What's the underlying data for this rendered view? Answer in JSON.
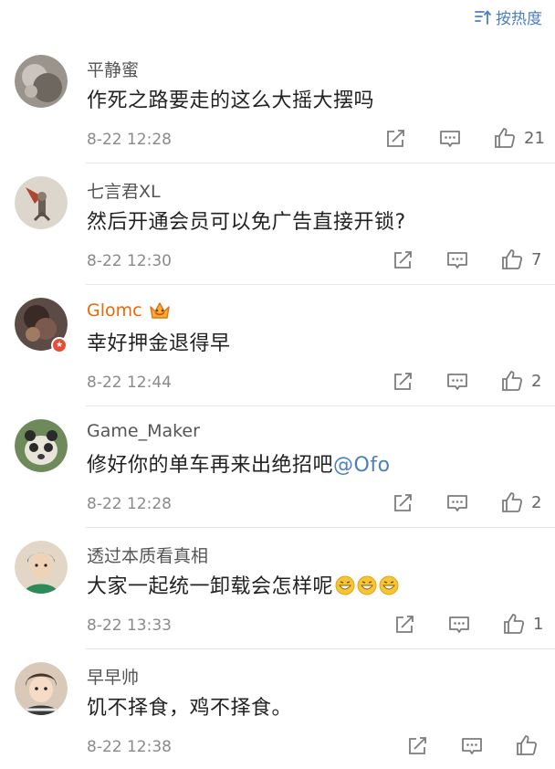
{
  "sort": {
    "label": "按热度",
    "icon": "sort-icon"
  },
  "comments": [
    {
      "user": "平静蜜",
      "text": "作死之路要走的这么大摇大摆吗",
      "time": "8-22 12:28",
      "likes": "21",
      "avatar_color": "#8a8580"
    },
    {
      "user": "七言君XL",
      "text": "然后开通会员可以免广告直接开锁?",
      "time": "8-22 12:30",
      "likes": "7",
      "avatar_color": "#c9c2b6"
    },
    {
      "user": "Glomc",
      "text": "幸好押金退得早",
      "time": "8-22 12:44",
      "likes": "2",
      "vip": true,
      "avatar_color": "#5c4a44",
      "accent_color": "#e8690a"
    },
    {
      "user": "Game_Maker",
      "text_before": "修好你的单车再来出绝招吧",
      "mention": "@Ofo",
      "time": "8-22 12:28",
      "likes": "2",
      "avatar_color": "#6f8a5a"
    },
    {
      "user": "透过本质看真相",
      "text": "大家一起统一卸载会怎样呢",
      "emojis": 3,
      "time": "8-22 13:33",
      "likes": "1",
      "avatar_color": "#e2d7c6"
    },
    {
      "user": "早早帅",
      "text": "饥不择食，鸡不择食。",
      "time": "8-22 12:38",
      "likes": "",
      "avatar_color": "#d9c9b8"
    }
  ],
  "colors": {
    "link": "#4a7fc1",
    "vip_name": "#e8690a",
    "icon": "#7c7c7c",
    "divider": "#e6e6e6"
  }
}
